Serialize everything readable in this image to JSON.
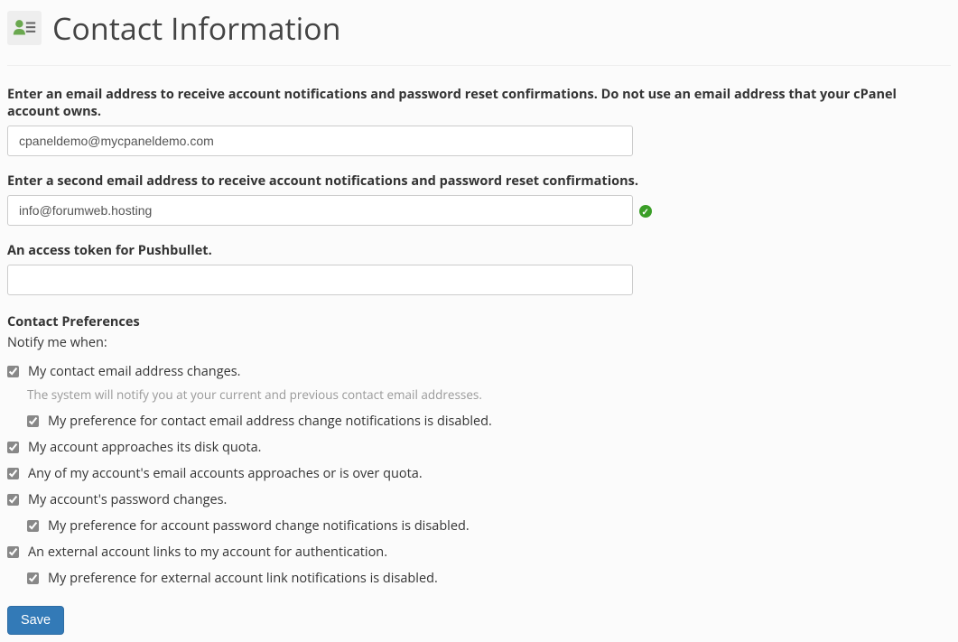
{
  "header": {
    "title": "Contact Information"
  },
  "fields": {
    "email1": {
      "label": "Enter an email address to receive account notifications and password reset confirmations. Do not use an email address that your cPanel account owns.",
      "value": "cpaneldemo@mycpaneldemo.com"
    },
    "email2": {
      "label": "Enter a second email address to receive account notifications and password reset confirmations.",
      "value": "info@forumweb.hosting"
    },
    "pushbullet": {
      "label": "An access token for Pushbullet.",
      "value": ""
    }
  },
  "preferences": {
    "heading": "Contact Preferences",
    "subheading": "Notify me when:",
    "items": [
      {
        "label": "My contact email address changes.",
        "checked": true,
        "helper": "The system will notify you at your current and previous contact email addresses.",
        "children": [
          {
            "label": "My preference for contact email address change notifications is disabled.",
            "checked": true
          }
        ]
      },
      {
        "label": "My account approaches its disk quota.",
        "checked": true,
        "children": []
      },
      {
        "label": "Any of my account's email accounts approaches or is over quota.",
        "checked": true,
        "children": []
      },
      {
        "label": "My account's password changes.",
        "checked": true,
        "children": [
          {
            "label": "My preference for account password change notifications is disabled.",
            "checked": true
          }
        ]
      },
      {
        "label": "An external account links to my account for authentication.",
        "checked": true,
        "children": [
          {
            "label": "My preference for external account link notifications is disabled.",
            "checked": true
          }
        ]
      }
    ]
  },
  "actions": {
    "save": "Save"
  }
}
